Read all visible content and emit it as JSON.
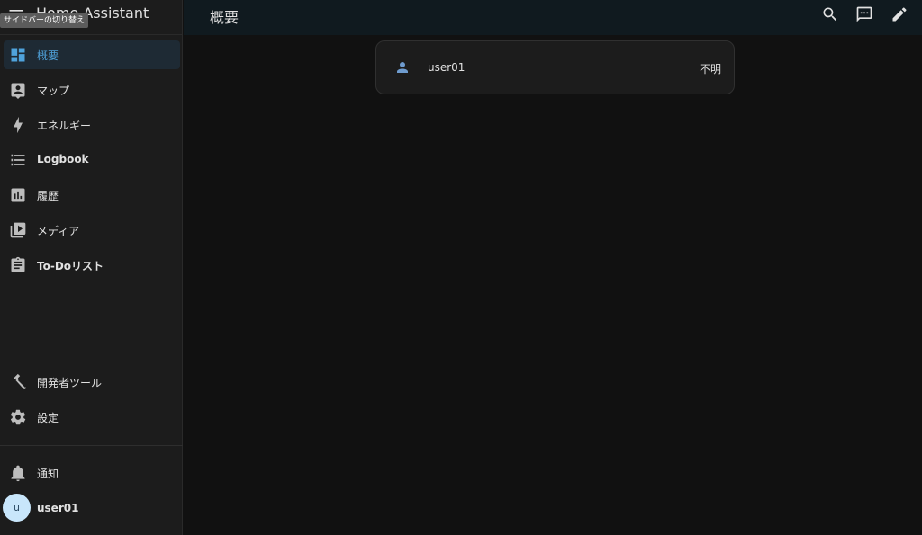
{
  "app": {
    "title": "Home Assistant",
    "toggle_tooltip": "サイドバーの切り替え"
  },
  "sidebar": {
    "items": [
      {
        "label": "概要",
        "icon": "dashboard-icon",
        "active": true
      },
      {
        "label": "マップ",
        "icon": "map-account-icon"
      },
      {
        "label": "エネルギー",
        "icon": "lightning-bolt-icon"
      },
      {
        "label": "Logbook",
        "icon": "format-list-bulleted-icon"
      },
      {
        "label": "履歴",
        "icon": "chart-box-icon"
      },
      {
        "label": "メディア",
        "icon": "play-box-multiple-icon"
      },
      {
        "label": "To-Doリスト",
        "icon": "clipboard-list-icon"
      }
    ],
    "bottom_items": [
      {
        "label": "開発者ツール",
        "icon": "hammer-icon"
      },
      {
        "label": "設定",
        "icon": "cog-icon"
      }
    ],
    "notifications": {
      "label": "通知",
      "icon": "bell-icon"
    },
    "user": {
      "initial": "u",
      "name": "user01"
    }
  },
  "header": {
    "title": "概要",
    "actions": [
      "search-icon",
      "assist-icon",
      "pencil-icon"
    ]
  },
  "main": {
    "card": {
      "entity_name": "user01",
      "state": "不明",
      "icon": "account-icon"
    }
  },
  "colors": {
    "accent": "#4fa3dc",
    "background": "#111111",
    "sidebar": "#1c1c1c",
    "header": "#101a1f"
  }
}
